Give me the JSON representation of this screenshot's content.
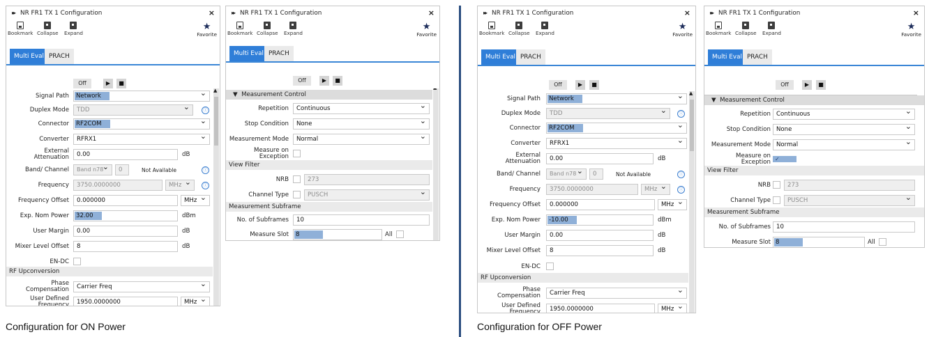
{
  "panel": {
    "title": "NR FR1 TX 1 Configuration",
    "close_glyph": "×",
    "expand_glyph": "▸▸",
    "toolbar": {
      "bookmark": "Bookmark",
      "collapse": "Collapse",
      "expand": "Expand",
      "favorite": "Favorite"
    },
    "tabs": {
      "multi_eval": "Multi Eval",
      "prach": "PRACH"
    },
    "run_state": "Off",
    "play_glyph": "▶",
    "stop_glyph": "■",
    "scroll_up_glyph": "▲"
  },
  "labels": {
    "signal_path": "Signal Path",
    "duplex_mode": "Duplex Mode",
    "connector": "Connector",
    "converter": "Converter",
    "external_attenuation": "External Attenuation",
    "band_channel": "Band/ Channel",
    "frequency": "Frequency",
    "frequency_offset": "Frequency Offset",
    "exp_nom_power": "Exp. Nom Power",
    "user_margin": "User Margin",
    "mixer_level_offset": "Mixer Level Offset",
    "en_dc": "EN-DC",
    "rf_upconversion": "RF Upconversion",
    "phase_compensation": "Phase Compensation",
    "user_defined_frequency": "User Defined Frequency",
    "measurement_control": "Measurement Control",
    "repetition": "Repetition",
    "stop_condition": "Stop Condition",
    "measurement_mode": "Measurement Mode",
    "measure_on_exception": "Measure on Exception",
    "view_filter": "View Filter",
    "nrb": "NRB",
    "channel_type": "Channel Type",
    "measurement_subframe": "Measurement Subframe",
    "no_of_subframes": "No. of Subframes",
    "measure_slot": "Measure Slot",
    "all": "All",
    "section_arrow": "▼"
  },
  "units": {
    "db": "dB",
    "dbm": "dBm",
    "mhz": "MHz"
  },
  "values": {
    "signal_path": "Network",
    "duplex_mode": "TDD",
    "connector": "RF2COM",
    "converter": "RFRX1",
    "external_attenuation": "0.00",
    "band": "Band n78",
    "channel": "0",
    "band_status": "Not Available",
    "frequency": "3750.0000000",
    "frequency_offset": "0.000000",
    "user_margin": "0.00",
    "mixer_level_offset": "8",
    "phase_compensation": "Carrier Freq",
    "user_defined_frequency": "1950.0000000",
    "repetition": "Continuous",
    "stop_condition": "None",
    "measurement_mode": "Normal",
    "nrb": "273",
    "channel_type": "PUSCH",
    "no_of_subframes": "10",
    "measure_slot": "8"
  },
  "on_power": {
    "exp_nom_power": "32.00",
    "caption": "Configuration for ON Power"
  },
  "off_power": {
    "exp_nom_power": "-10.00",
    "exception_check": "✓",
    "caption": "Configuration for OFF Power"
  }
}
